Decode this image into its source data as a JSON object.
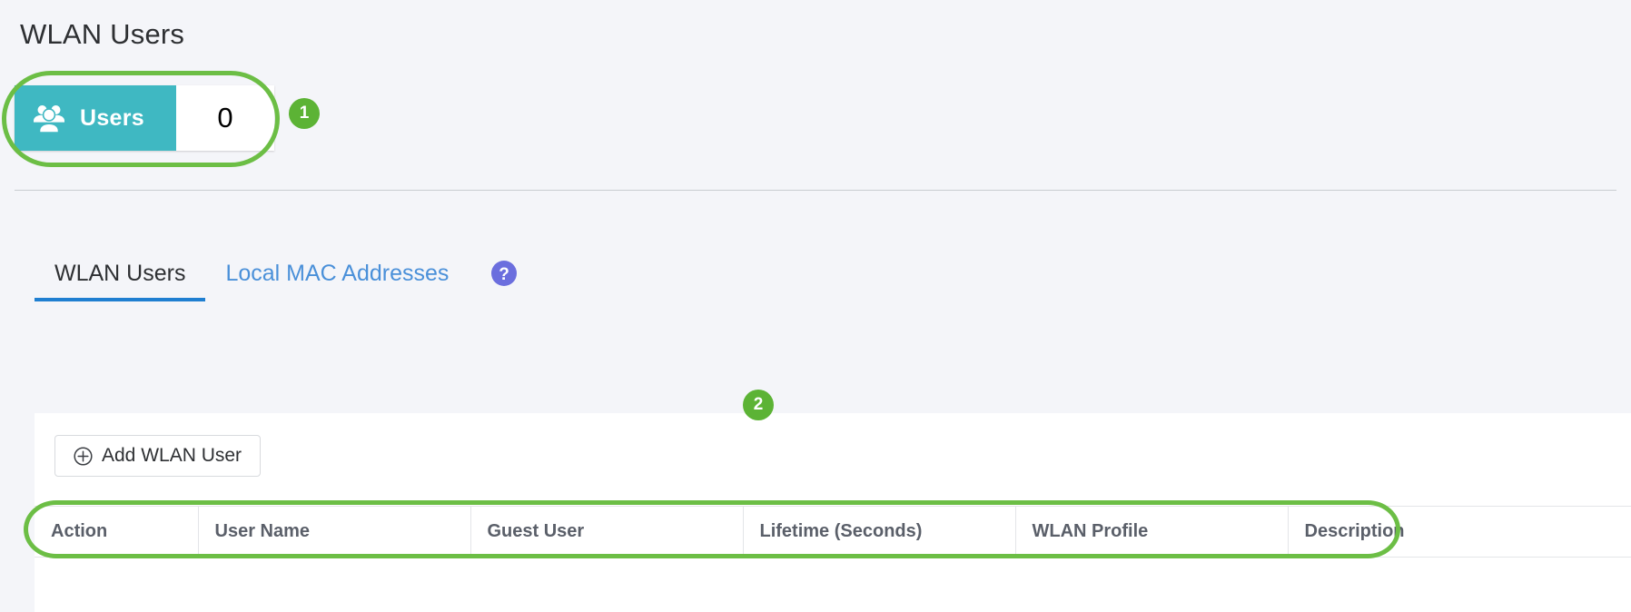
{
  "page": {
    "title": "WLAN Users"
  },
  "stat": {
    "icon": "users-group-icon",
    "label": "Users",
    "value": "0"
  },
  "annotations": {
    "badges": [
      {
        "number": "1"
      },
      {
        "number": "2"
      }
    ]
  },
  "tabs": [
    {
      "label": "WLAN Users",
      "active": true
    },
    {
      "label": "Local MAC Addresses",
      "active": false
    }
  ],
  "help": {
    "icon": "help-question-icon"
  },
  "toolbar": {
    "add_icon": "plus-circle-icon",
    "add_label": "Add WLAN User"
  },
  "table": {
    "columns": [
      "Action",
      "User Name",
      "Guest User",
      "Lifetime (Seconds)",
      "WLAN Profile",
      "Description"
    ],
    "rows": []
  },
  "colors": {
    "page_background": "#f4f5f9",
    "stat_badge": "#3fb8c2",
    "annotation_green": "#6cbe45",
    "badge_green": "#5cb335",
    "tab_active_underline": "#1f7fd1",
    "tab_inactive_text": "#4a90d9",
    "help_icon": "#6b6ede"
  }
}
